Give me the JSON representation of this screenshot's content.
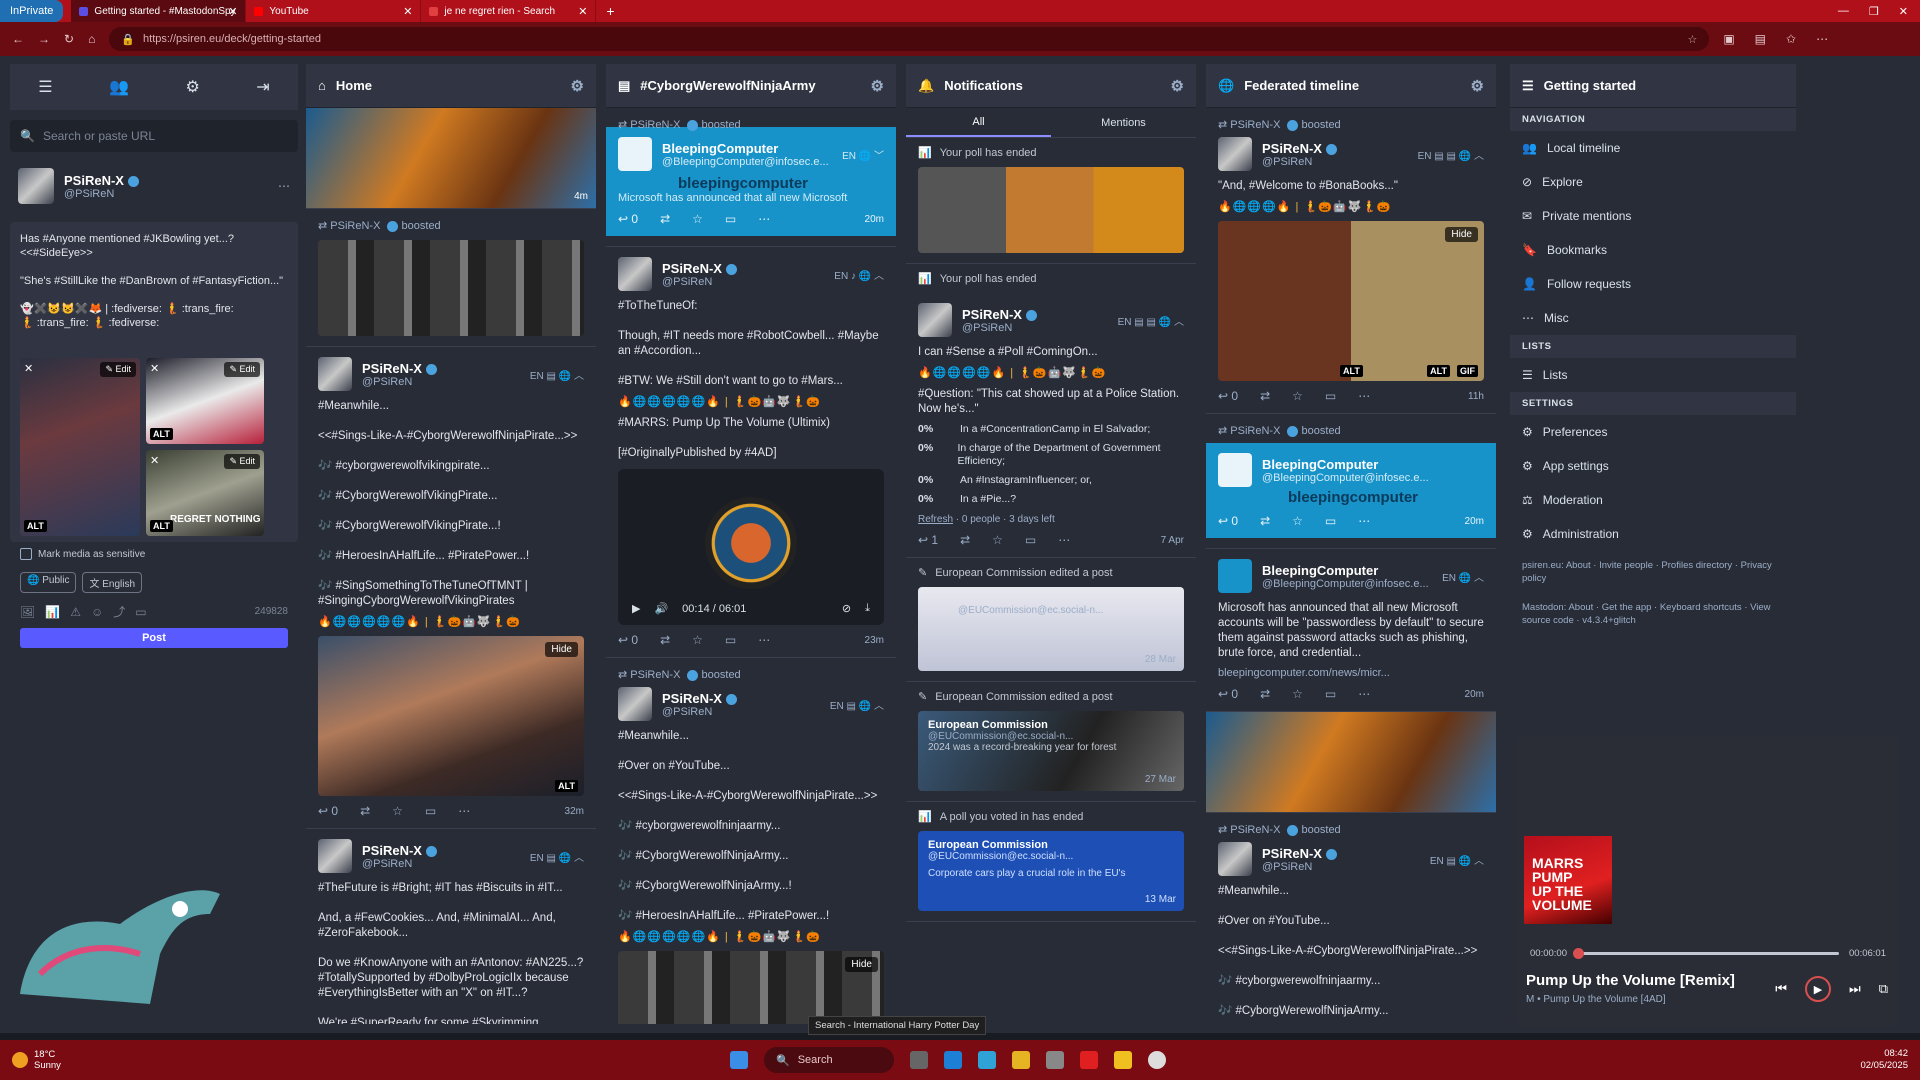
{
  "browser": {
    "inprivate": "InPrivate",
    "tabs": [
      {
        "title": "Getting started - #MastodonSpy",
        "color": "#5c4ee5"
      },
      {
        "title": "YouTube",
        "color": "#ff0000"
      },
      {
        "title": "je ne regret rien - Search",
        "color": "#e04040"
      }
    ],
    "new_tab": "+",
    "url": "https://psiren.eu/deck/getting-started"
  },
  "drawer": {
    "search_placeholder": "Search or paste URL",
    "me_name": "PSiReN-X",
    "me_handle": "@PSiReN",
    "compose_text": "Has #Anyone mentioned #JKBowling yet...?\n<<#SideEye>>\n\n\"She's #StillLike the #DanBrown of #FantasyFiction...\"\n\n👻✖️😺😺✖️🦊 | :fediverse: 🧜 :trans_fire:\n🧜 :trans_fire: 🧜 :fediverse:",
    "media_tags": [
      "ALT",
      "ALT",
      "ALT"
    ],
    "edit_label": "Edit",
    "thumb_caption": "REGRET NOTHING",
    "sensitive_label": "Mark media as sensitive",
    "visibility": "Public",
    "language": "English",
    "counter": "249828",
    "post_label": "Post"
  },
  "columns": {
    "home": {
      "title": "Home",
      "boosted": "boosted",
      "user": "PSiReN-X",
      "handle": "@PSiReN",
      "lang": "EN",
      "post1_text": "#Meanwhile...\n\n<<#Sings-Like-A-#CyborgWerewolfNinjaPirate...>>\n\n🎶 #cyborgwerewolfvikingpirate...\n\n🎶 #CyborgWerewolfVikingPirate...\n\n🎶 #CyborgWerewolfVikingPirate...!\n\n🎶 #HeroesInAHalfLife... #PiratePower...!\n\n🎶 #SingSomethingToTheTuneOfTMNT  |\n#SingingCyborgWerewolfVikingPirates",
      "hide": "Hide",
      "alt": "ALT",
      "post2_text": "#TheFuture is #Bright; #IT has #Biscuits in #IT...\n\nAnd, a #FewCookies... And, #MinimalAI... And, #ZeroFakebook...\n\nDo we #KnowAnyone with an #Antonov: #AN225...? #TotallySupported by #DolbyProLogicIIx because #EverythingIsBetter with an \"X\" on #IT...?\n\nWe're #SuperReady for some #Skyrimming...",
      "reply_count": "0",
      "time1": "32m",
      "time0": "4m"
    },
    "cyborg": {
      "title": "#CyborgWerewolfNinjaArmy",
      "boosted": "boosted",
      "boost_user": "PSiReN-X",
      "bleep_name": "BleepingComputer",
      "bleep_handle": "@BleepingComputer@infosec.e...",
      "bleep_text": "Microsoft has announced that all new Microsoft",
      "bleep_logo": "bleepingcomputer",
      "bleep_time": "20m",
      "user": "PSiReN-X",
      "handle": "@PSiReN",
      "lang": "EN",
      "post1_text": "#ToTheTuneOf:\n\nThough, #IT needs more #RobotCowbell... #Maybe an #Accordion...\n\n#BTW: We #Still don't want to go to #Mars...",
      "post1_text2": "#MARRS: Pump Up The Volume (Ultimix)\n\n[#OriginallyPublished by #4AD]",
      "audio_time": "00:14 / 06:01",
      "time1": "23m",
      "post2_text": "#Meanwhile...\n\n#Over on #YouTube...\n\n<<#Sings-Like-A-#CyborgWerewolfNinjaPirate...>>\n\n🎶 #cyborgwerewolfninjaarmy...\n\n🎶 #CyborgWerewolfNinjaArmy...\n\n🎶 #CyborgWerewolfNinjaArmy...!\n\n🎶 #HeroesInAHalfLife... #PiratePower...!",
      "hide": "Hide",
      "reply_count": "0"
    },
    "notifications": {
      "title": "Notifications",
      "tab_all": "All",
      "tab_mentions": "Mentions",
      "poll_ended": "Your poll has ended",
      "user": "PSiReN-X",
      "handle": "@PSiReN",
      "lang": "EN",
      "poll_intro": "I can #Sense a #Poll #ComingOn...",
      "poll_question": "#Question: \"This cat showed up at a Police Station. Now he's...\"",
      "options": [
        {
          "pct": "0%",
          "text": "In a #ConcentrationCamp in El Salvador;"
        },
        {
          "pct": "0%",
          "text": "In charge of the Department of Government Efficiency;"
        },
        {
          "pct": "0%",
          "text": "An #InstagramInfluencer; or,"
        },
        {
          "pct": "0%",
          "text": "In a #Pie...?"
        }
      ],
      "refresh": "Refresh",
      "poll_meta": "· 0 people · 3 days left",
      "date1": "7 Apr",
      "ec_edited": "European Commission edited a post",
      "ec_name": "European Commission",
      "ec_handle": "@EUCommission@ec.social-n...",
      "ec_text": "2024 was a record-breaking year for forest",
      "ec_date1": "28 Mar",
      "ec_date2": "27 Mar",
      "poll_voted": "A poll you voted in has ended",
      "ec_text2": "Corporate cars play a crucial role in the EU's",
      "ec_date3": "13 Mar",
      "reply_count1": "1",
      "reply_count0": "0"
    },
    "federated": {
      "title": "Federated timeline",
      "boosted": "boosted",
      "user": "PSiReN-X",
      "handle": "@PSiReN",
      "lang": "EN",
      "post1_text": "\"And, #Welcome to #BonaBooks...\"",
      "hide": "Hide",
      "alt": "ALT",
      "gif": "GIF",
      "time1": "11h",
      "bleep_name": "BleepingComputer",
      "bleep_handle": "@BleepingComputer@infosec.e...",
      "bleep_logo": "bleepingcomputer",
      "bleep_time": "20m",
      "bleep_text": "Microsoft has announced that all new Microsoft accounts will be \"passwordless by default\" to secure them against password attacks such as phishing, brute force, and credential...",
      "bleep_link": "bleepingcomputer.com/news/micr...",
      "bleep_time2": "20m",
      "post3_text": "#Meanwhile...\n\n#Over on #YouTube...\n\n<<#Sings-Like-A-#CyborgWerewolfNinjaPirate...>>\n\n🎶 #cyborgwerewolfninjaarmy...\n\n🎶 #CyborgWerewolfNinjaArmy...",
      "reply_count": "0"
    }
  },
  "getting_started": {
    "title": "Getting started",
    "nav_label": "NAVIGATION",
    "nav": [
      "Local timeline",
      "Explore",
      "Private mentions",
      "Bookmarks",
      "Follow requests",
      "Misc"
    ],
    "lists_label": "LISTS",
    "lists": [
      "Lists"
    ],
    "settings_label": "SETTINGS",
    "settings": [
      "Preferences",
      "App settings",
      "Moderation",
      "Administration"
    ],
    "footer1": "psiren.eu: About · Invite people · Profiles directory · Privacy policy",
    "footer2": "Mastodon: About · Get the app · Keyboard shortcuts · View source code · v4.3.4+glitch"
  },
  "player": {
    "album_text": "MARRS\nPUMP\nUP THE\nVOLUME",
    "elapsed": "00:00:00",
    "duration": "00:06:01",
    "progress": 0.0,
    "title": "Pump Up the Volume [Remix]",
    "subtitle": "M • Pump Up the Volume [4AD]"
  },
  "tooltip": "Search - International Harry Potter Day",
  "taskbar": {
    "temp": "18°C",
    "weather": "Sunny",
    "search": "Search",
    "time": "08:42",
    "date": "02/05/2025"
  },
  "colors": {
    "accent": "#595aff",
    "hashtag": "#8c8dff",
    "bleeping": "#1893c9",
    "browser_red": "#b0101a"
  }
}
